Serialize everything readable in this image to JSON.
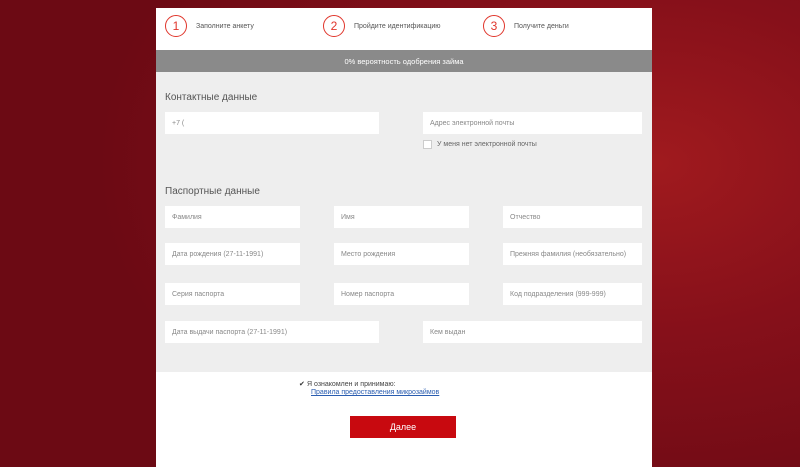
{
  "steps": [
    {
      "number": "1",
      "label": "Заполните анкету"
    },
    {
      "number": "2",
      "label": "Пройдите идентификацию"
    },
    {
      "number": "3",
      "label": "Получите деньги"
    }
  ],
  "approval_text": "0% вероятность одобрения займа",
  "contact": {
    "title": "Контактные данные",
    "phone_placeholder": "+7 (",
    "email_placeholder": "Адрес электронной почты",
    "no_email_label": "У меня нет электронной почты"
  },
  "passport": {
    "title": "Паспортные данные",
    "fields": {
      "last_name": "Фамилия",
      "first_name": "Имя",
      "patronymic": "Отчество",
      "birth_date": "Дата рождения (27-11-1991)",
      "birth_place": "Место рождения",
      "previous_surname": "Прежняя фамилия (необязательно)",
      "passport_series": "Серия паспорта",
      "passport_number": "Номер паспорта",
      "division_code": "Код подразделения (999-999)",
      "issue_date": "Дата выдачи паспорта (27-11-1991)",
      "issued_by": "Кем выдан"
    }
  },
  "agreement": {
    "text": "Я ознакомлен и принимаю:",
    "link": "Правила предоставления микрозаймов"
  },
  "next_button": "Далее",
  "colors": {
    "accent": "#c8090f",
    "step_circle": "#e0352b",
    "background": "#86101a",
    "approval_bar": "#8a8a8a",
    "form_bg": "#eeeeee"
  }
}
